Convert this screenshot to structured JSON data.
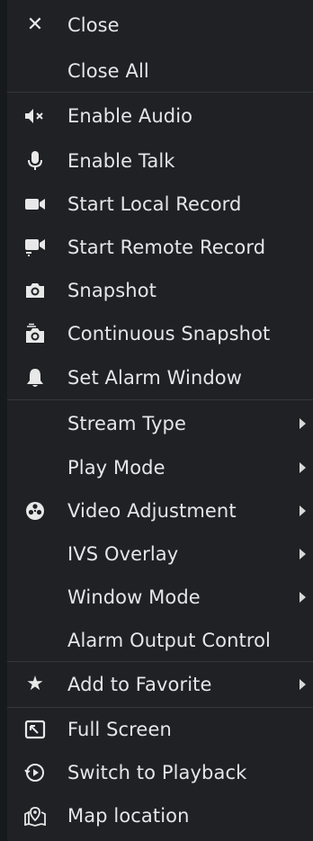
{
  "menu": {
    "items": [
      {
        "label": "Close",
        "icon": "close-icon",
        "glyph": "✕"
      },
      {
        "label": "Close All"
      },
      {
        "label": "Enable Audio",
        "icon": "audio-muted-icon"
      },
      {
        "label": "Enable Talk",
        "icon": "microphone-icon"
      },
      {
        "label": "Start Local Record",
        "icon": "video-camera-icon"
      },
      {
        "label": "Start Remote Record",
        "icon": "remote-record-icon"
      },
      {
        "label": "Snapshot",
        "icon": "camera-icon"
      },
      {
        "label": "Continuous Snapshot",
        "icon": "continuous-camera-icon"
      },
      {
        "label": "Set Alarm Window",
        "icon": "bell-icon"
      },
      {
        "label": "Stream Type",
        "submenu": true
      },
      {
        "label": "Play Mode",
        "submenu": true
      },
      {
        "label": "Video Adjustment",
        "icon": "adjustment-icon",
        "submenu": true
      },
      {
        "label": "IVS Overlay",
        "submenu": true
      },
      {
        "label": "Window Mode",
        "submenu": true
      },
      {
        "label": "Alarm Output Control"
      },
      {
        "label": "Add to Favorite",
        "icon": "star-icon",
        "glyph": "★",
        "submenu": true
      },
      {
        "label": "Full Screen",
        "icon": "fullscreen-icon"
      },
      {
        "label": "Switch to Playback",
        "icon": "playback-icon"
      },
      {
        "label": "Map location",
        "icon": "map-location-icon"
      }
    ]
  }
}
